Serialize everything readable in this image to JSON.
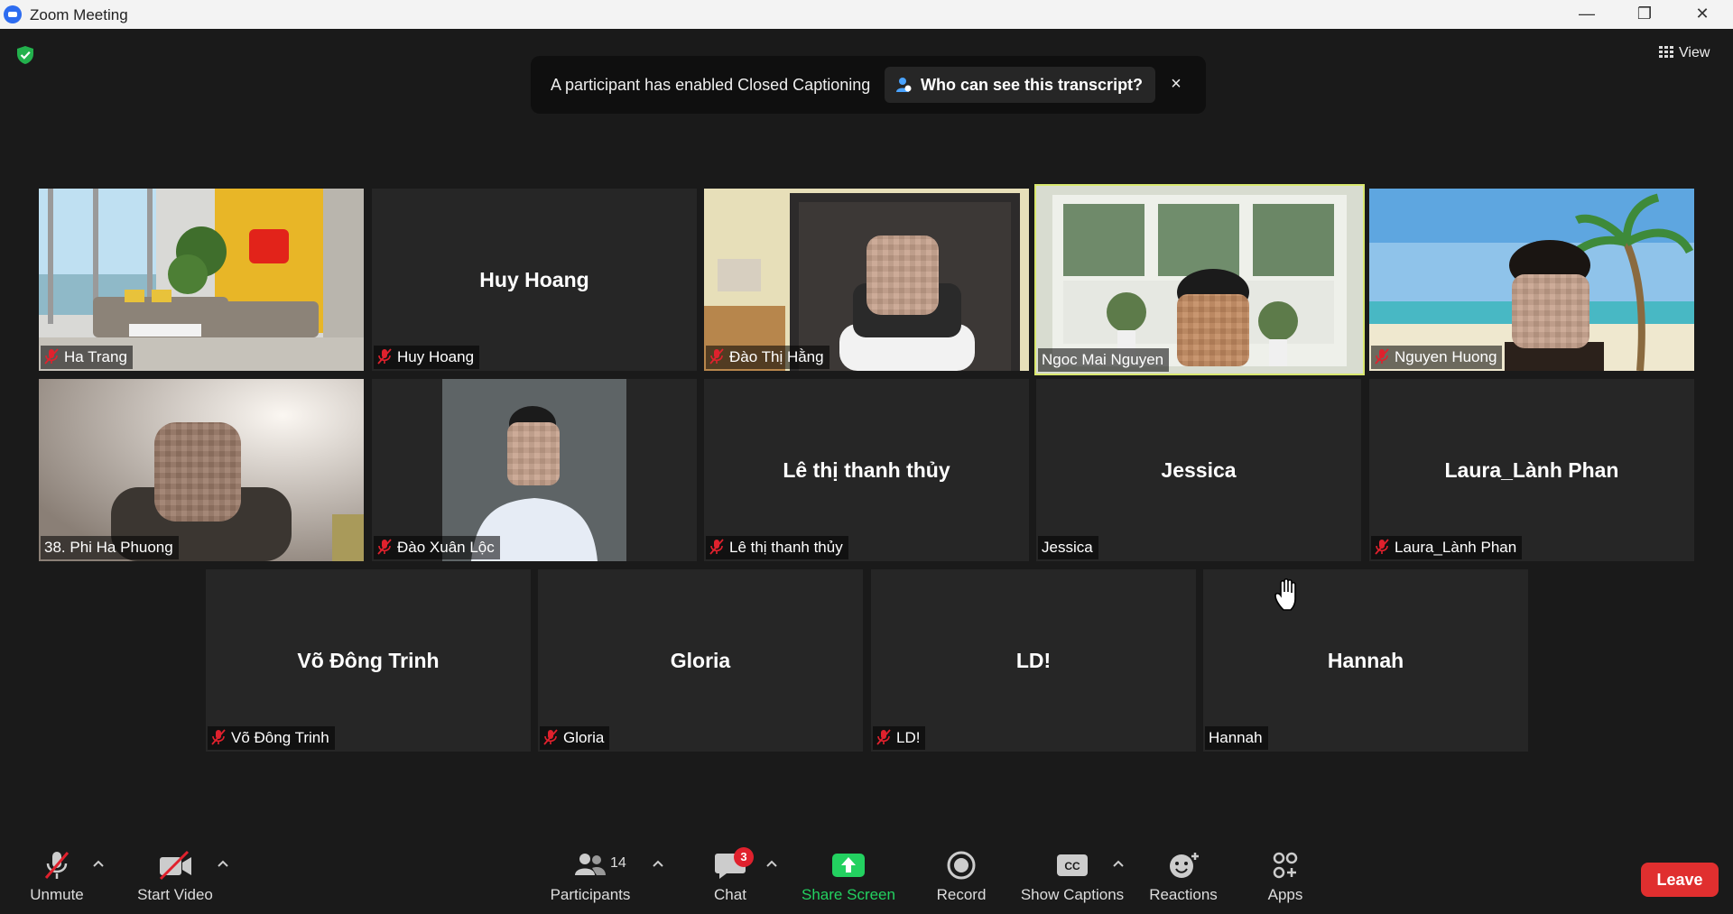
{
  "window": {
    "title": "Zoom Meeting",
    "controls": [
      "minimize",
      "restore",
      "close"
    ]
  },
  "view_button": {
    "label": "View"
  },
  "banner": {
    "message": "A participant has enabled Closed Captioning",
    "link": "Who can see this transcript?",
    "close": "×"
  },
  "tiles": [
    {
      "name": "Ha Trang",
      "display": "",
      "muted": true,
      "video": true
    },
    {
      "name": "Huy Hoang",
      "display": "Huy Hoang",
      "muted": true,
      "video": false
    },
    {
      "name": "Đào Thị Hằng",
      "display": "",
      "muted": true,
      "video": true
    },
    {
      "name": "Ngoc Mai Nguyen",
      "display": "",
      "muted": false,
      "video": true,
      "active_speaker": true
    },
    {
      "name": "Nguyen Huong",
      "display": "",
      "muted": true,
      "video": true
    },
    {
      "name": "38. Phi Ha Phuong",
      "display": "",
      "muted": false,
      "video": true
    },
    {
      "name": "Đào Xuân Lộc",
      "display": "",
      "muted": true,
      "video": true
    },
    {
      "name": "Lê thị thanh thủy",
      "display": "Lê thị thanh thủy",
      "muted": true,
      "video": false
    },
    {
      "name": "Jessica",
      "display": "Jessica",
      "muted": false,
      "video": false
    },
    {
      "name": "Laura_Lành Phan",
      "display": "Laura_Lành Phan",
      "muted": true,
      "video": false
    },
    {
      "name": "Võ Đông Trinh",
      "display": "Võ Đông Trinh",
      "muted": true,
      "video": false
    },
    {
      "name": "Gloria",
      "display": "Gloria",
      "muted": true,
      "video": false
    },
    {
      "name": "LD!",
      "display": "LD!",
      "muted": true,
      "video": false
    },
    {
      "name": "Hannah",
      "display": "Hannah",
      "muted": false,
      "video": false
    }
  ],
  "toolbar": {
    "unmute": "Unmute",
    "start_video": "Start Video",
    "participants": "Participants",
    "participants_count": "14",
    "chat": "Chat",
    "chat_badge": "3",
    "share_screen": "Share Screen",
    "record": "Record",
    "show_captions": "Show Captions",
    "reactions": "Reactions",
    "apps": "Apps",
    "leave": "Leave"
  },
  "colors": {
    "background": "#1a1a1a",
    "tile": "#262626",
    "active_border": "#d9e86e",
    "share_green": "#23d160",
    "leave_red": "#e02f2f",
    "mute_red": "#e0212d"
  }
}
